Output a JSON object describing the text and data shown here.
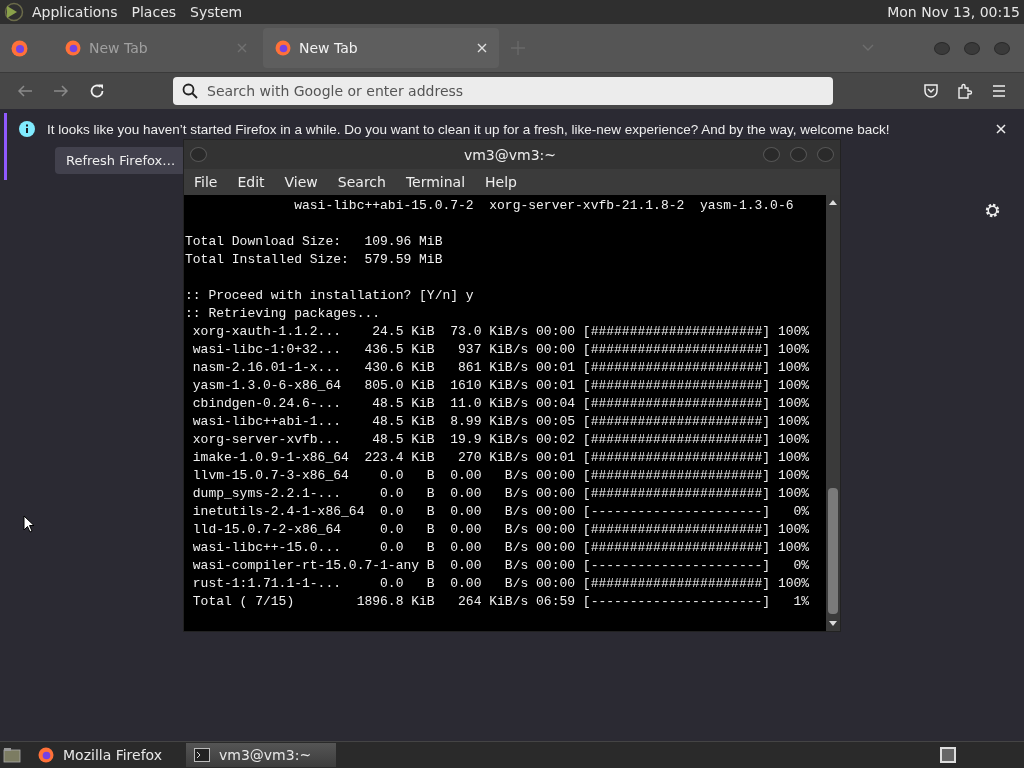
{
  "top_panel": {
    "menus": [
      "Applications",
      "Places",
      "System"
    ],
    "clock": "Mon Nov 13, 00:15"
  },
  "browser": {
    "tabs": [
      {
        "label": "New Tab",
        "selected": false
      },
      {
        "label": "New Tab",
        "selected": true
      }
    ],
    "address_bar": {
      "placeholder": "Search with Google or enter address"
    },
    "notification": {
      "message": "It looks like you haven’t started Firefox in a while. Do you want to clean it up for a fresh, like-new experience? And by the way, welcome back!",
      "button": "Refresh Firefox…"
    }
  },
  "terminal": {
    "title": "vm3@vm3:~",
    "menus": [
      "File",
      "Edit",
      "View",
      "Search",
      "Terminal",
      "Help"
    ],
    "blocks": [
      [
        "              wasi-libc++abi-15.0.7-2  xorg-server-xvfb-21.1.8-2  yasm-1.3.0-6"
      ],
      [
        "Total Download Size:   109.96 MiB",
        "Total Installed Size:  579.59 MiB"
      ],
      [
        ":: Proceed with installation? [Y/n] y",
        ":: Retrieving packages...",
        " xorg-xauth-1.1.2...    24.5 KiB  73.0 KiB/s 00:00 [######################] 100%",
        " wasi-libc-1:0+32...   436.5 KiB   937 KiB/s 00:00 [######################] 100%",
        " nasm-2.16.01-1-x...   430.6 KiB   861 KiB/s 00:01 [######################] 100%",
        " yasm-1.3.0-6-x86_64   805.0 KiB  1610 KiB/s 00:01 [######################] 100%",
        " cbindgen-0.24.6-...    48.5 KiB  11.0 KiB/s 00:04 [######################] 100%",
        " wasi-libc++abi-1...    48.5 KiB  8.99 KiB/s 00:05 [######################] 100%",
        " xorg-server-xvfb...    48.5 KiB  19.9 KiB/s 00:02 [######################] 100%",
        " imake-1.0.9-1-x86_64  223.4 KiB   270 KiB/s 00:01 [######################] 100%",
        " llvm-15.0.7-3-x86_64    0.0   B  0.00   B/s 00:00 [######################] 100%",
        " dump_syms-2.2.1-...     0.0   B  0.00   B/s 00:00 [######################] 100%",
        " inetutils-2.4-1-x86_64  0.0   B  0.00   B/s 00:00 [----------------------]   0%",
        " lld-15.0.7-2-x86_64     0.0   B  0.00   B/s 00:00 [######################] 100%",
        " wasi-libc++-15.0...     0.0   B  0.00   B/s 00:00 [######################] 100%",
        " wasi-compiler-rt-15.0.7-1-any B  0.00   B/s 00:00 [----------------------]   0%",
        " rust-1:1.71.1-1-...     0.0   B  0.00   B/s 00:00 [######################] 100%",
        " Total ( 7/15)        1896.8 KiB   264 KiB/s 06:59 [----------------------]   1%"
      ]
    ]
  },
  "taskbar": {
    "tasks": [
      {
        "label": "Mozilla Firefox",
        "kind": "browser",
        "selected": false
      },
      {
        "label": "vm3@vm3:~",
        "kind": "terminal",
        "selected": true
      }
    ]
  }
}
